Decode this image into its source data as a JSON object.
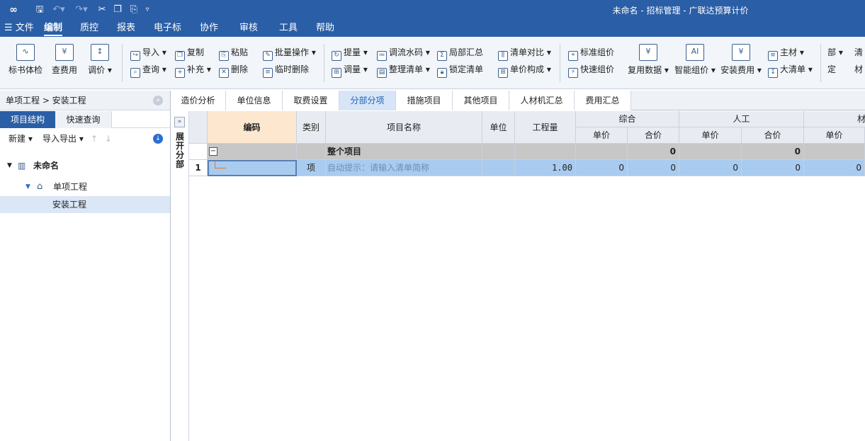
{
  "window": {
    "title": "未命名 - 招标管理 - 广联达预算计价"
  },
  "quick_access": {
    "logo_icon": "app-logo-icon",
    "icons": [
      "save-icon",
      "undo-icon",
      "redo-icon",
      "cut-icon",
      "copy-icon",
      "paste-icon",
      "more-icon"
    ]
  },
  "menu": {
    "file": "☰ 文件",
    "items": [
      "编制",
      "质控",
      "报表",
      "电子标",
      "协作",
      "审核",
      "工具",
      "帮助"
    ],
    "active": "编制"
  },
  "ribbon": {
    "big": {
      "biaoshu": "标书体检",
      "chafeiyong": "查费用",
      "tiaojia": "调价 ▾",
      "fuyong": "复用数据 ▾",
      "zhineng": "智能组价 ▾",
      "anzhuang": "安装费用 ▾"
    },
    "small": {
      "daoru": "导入 ▾",
      "fuzhi": "复制",
      "niantie": "粘贴",
      "piliang": "批量操作 ▾",
      "chaxun": "查询 ▾",
      "buchong": "补充 ▾",
      "shanchu": "删除",
      "linshi": "临时删除",
      "tiliang": "提量 ▾",
      "tiaoliu": "调流水码 ▾",
      "jubu": "局部汇总",
      "qingdan_duibi": "清单对比 ▾",
      "tiaoliang": "调量 ▾",
      "zhengli": "整理清单 ▾",
      "suoding": "锁定清单",
      "danjia_goucheng": "单价构成 ▾",
      "biaozhun": "标准组价",
      "kuaisu": "快速组价",
      "zhucai": "主材 ▾",
      "daqingdan": "大清单 ▾",
      "bu": "部 ▾",
      "qing": "清",
      "ding": "定",
      "cai": "材"
    }
  },
  "left_panel": {
    "breadcrumb": "单项工程 > 安装工程",
    "tabs": [
      "项目结构",
      "快速查询"
    ],
    "toolbar": {
      "new": "新建 ▾",
      "import_export": "导入导出 ▾",
      "up": "↑",
      "down": "↓"
    },
    "tree": [
      {
        "label": "未命名",
        "level": 0
      },
      {
        "label": "单项工程",
        "level": 1
      },
      {
        "label": "安装工程",
        "level": 2,
        "selected": true
      }
    ]
  },
  "main_tabs": [
    "造价分析",
    "单位信息",
    "取费设置",
    "分部分项",
    "措施项目",
    "其他项目",
    "人材机汇总",
    "费用汇总"
  ],
  "active_main_tab": "分部分项",
  "side_strip": {
    "expand_button": "»",
    "label": "展开分部"
  },
  "grid": {
    "headers": {
      "code": "编码",
      "type": "类别",
      "name": "项目名称",
      "unit": "单位",
      "qty": "工程量",
      "group_zonghe": "综合",
      "group_rengong": "人工",
      "group_cai": "材",
      "unit_price": "单价",
      "total_price": "合价"
    },
    "group_row": {
      "toggle": "−",
      "name": "整个项目",
      "zonghe_total": "0",
      "rengong_total": "0"
    },
    "rows": [
      {
        "index": "1",
        "code": "",
        "type": "项",
        "name_hint": "自动提示：请输入清单简称",
        "qty": "1.00",
        "zonghe_unit": "0",
        "zonghe_total": "0",
        "rengong_unit": "0",
        "rengong_total": "0",
        "cai_unit": "0"
      }
    ]
  },
  "colors": {
    "brand": "#2a5ea6",
    "active_tab_text": "#1e5eb8",
    "selected_row": "#a9cbef",
    "group_row": "#c7c7c7",
    "code_header": "#fde8cf"
  }
}
